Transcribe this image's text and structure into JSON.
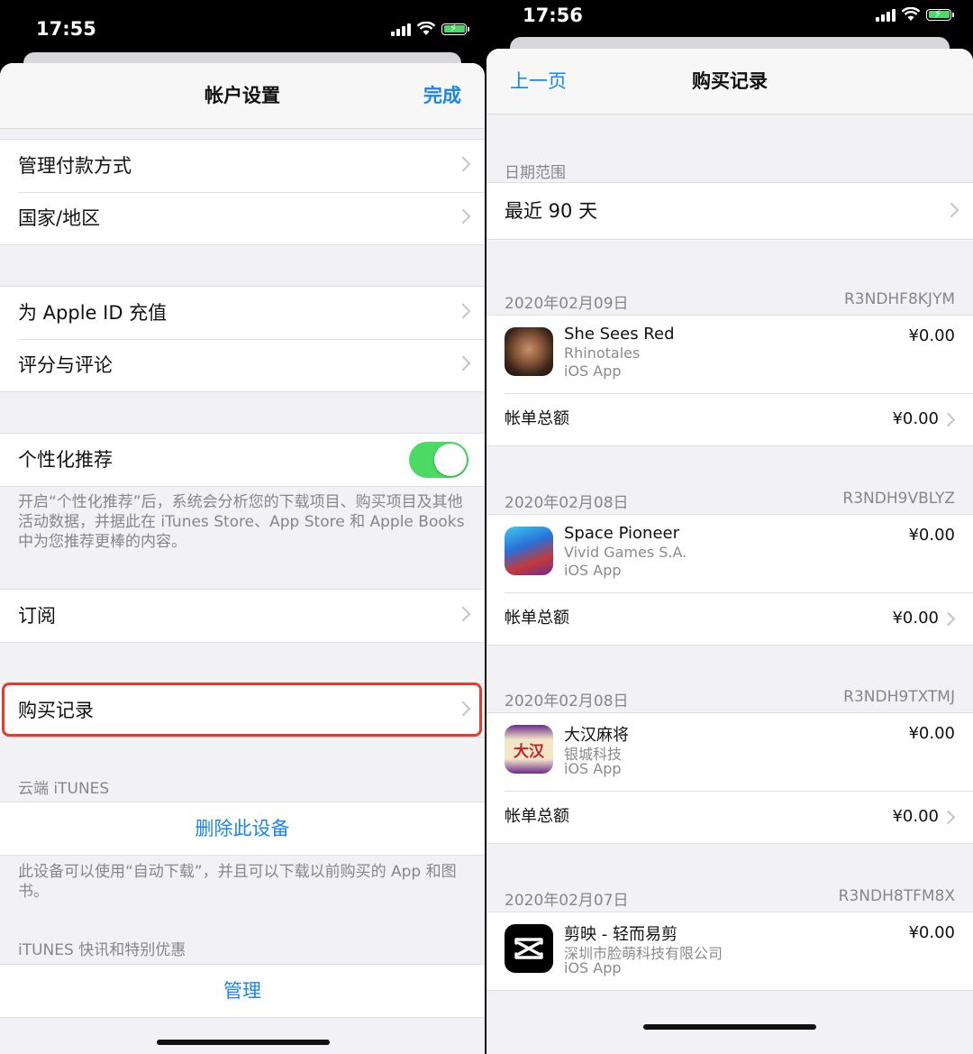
{
  "left": {
    "status_time": "17:55",
    "nav": {
      "title": "帐户设置",
      "done": "完成"
    },
    "rows": {
      "payment": "管理付款方式",
      "region": "国家/地区",
      "topup": "为 Apple ID 充值",
      "ratings": "评分与评论",
      "personalized": "个性化推荐",
      "subscriptions": "订阅",
      "purchase_history": "购买记录"
    },
    "personalized_note": "开启“个性化推荐”后，系统会分析您的下载项目、购买项目及其他活动数据，并据此在 iTunes Store、App Store 和 Apple Books 中为您推荐更棒的内容。",
    "cloud_header": "云端 iTUNES",
    "remove_device": "删除此设备",
    "device_note": "此设备可以使用“自动下载”，并且可以下载以前购买的 App 和图书。",
    "news_header": "iTUNES 快讯和特别优惠",
    "manage": "管理",
    "toggle_on": true,
    "highlight_color": "#e8392a"
  },
  "right": {
    "status_time": "17:56",
    "nav": {
      "back": "上一页",
      "title": "购买记录"
    },
    "date_range_header": "日期范围",
    "date_range_value": "最近 90 天",
    "orders": [
      {
        "date": "2020年02月09日",
        "id": "R3NDHF8KJYM",
        "name": "She Sees Red",
        "developer": "Rhinotales",
        "kind": "iOS App",
        "price": "¥0.00",
        "total_label": "帐单总额",
        "total": "¥0.00",
        "icon": "she-sees-red-app-icon"
      },
      {
        "date": "2020年02月08日",
        "id": "R3NDH9VBLYZ",
        "name": "Space Pioneer",
        "developer": "Vivid Games S.A.",
        "kind": "iOS App",
        "price": "¥0.00",
        "total_label": "帐单总额",
        "total": "¥0.00",
        "icon": "space-pioneer-app-icon"
      },
      {
        "date": "2020年02月08日",
        "id": "R3NDH9TXTMJ",
        "name": "大汉麻将",
        "developer": "银城科技",
        "kind": "iOS App",
        "price": "¥0.00",
        "total_label": "帐单总额",
        "total": "¥0.00",
        "icon": "dahan-mahjong-app-icon",
        "icon_text": "大汉"
      },
      {
        "date": "2020年02月07日",
        "id": "R3NDH8TFM8X",
        "name": "剪映 - 轻而易剪",
        "developer": "深圳市脸萌科技有限公司",
        "kind": "iOS App",
        "price": "¥0.00",
        "icon": "capcut-app-icon"
      }
    ]
  },
  "colors": {
    "accent": "#1a84ef",
    "toggle": "#4cd964",
    "background": "#f1f1f6"
  }
}
